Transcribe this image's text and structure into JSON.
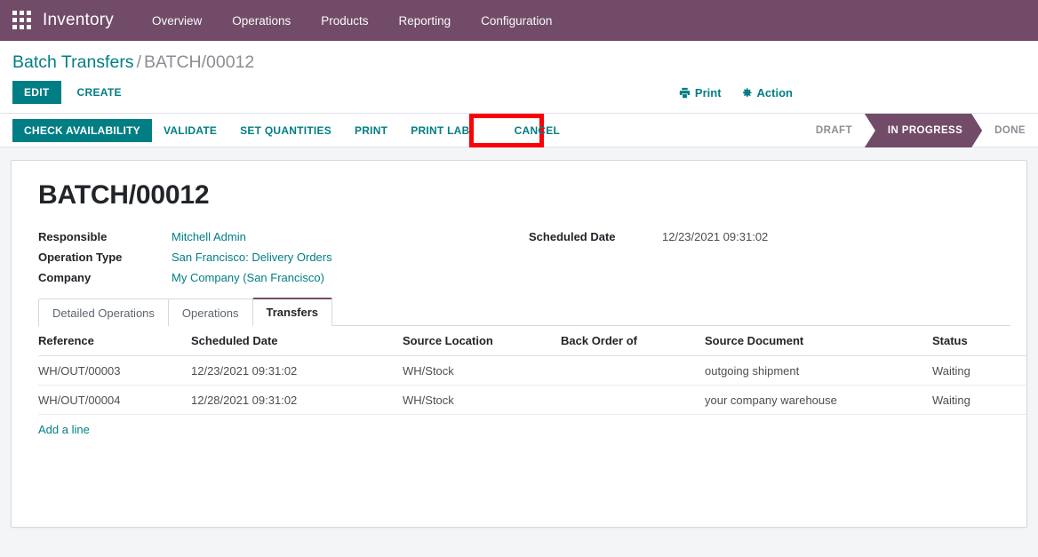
{
  "navbar": {
    "apps_icon": "apps-grid-icon",
    "brand": "Inventory",
    "menus": [
      {
        "label": "Overview"
      },
      {
        "label": "Operations"
      },
      {
        "label": "Products"
      },
      {
        "label": "Reporting"
      },
      {
        "label": "Configuration"
      }
    ]
  },
  "control_panel": {
    "breadcrumb": {
      "root": "Batch Transfers",
      "separator": "/",
      "current": "BATCH/00012"
    },
    "edit_label": "EDIT",
    "create_label": "CREATE",
    "print_label": "Print",
    "print_icon": "printer-icon",
    "action_label": "Action",
    "action_icon": "gear-icon"
  },
  "statusbar": {
    "buttons": [
      {
        "label": "CHECK AVAILABILITY",
        "style": "primary",
        "highlighted": false
      },
      {
        "label": "VALIDATE",
        "style": "secondary",
        "highlighted": false
      },
      {
        "label": "SET QUANTITIES",
        "style": "secondary",
        "highlighted": false
      },
      {
        "label": "PRINT",
        "style": "secondary",
        "highlighted": false
      },
      {
        "label": "PRINT LABELS",
        "style": "secondary",
        "highlighted": false
      },
      {
        "label": "CANCEL",
        "style": "secondary",
        "highlighted": true
      }
    ],
    "stages": [
      {
        "label": "DRAFT",
        "active": false
      },
      {
        "label": "IN PROGRESS",
        "active": true
      },
      {
        "label": "DONE",
        "active": false
      }
    ],
    "highlight_color": "#fb0007"
  },
  "form": {
    "title": "BATCH/00012",
    "left_fields": [
      {
        "label": "Responsible",
        "value": "Mitchell Admin",
        "link": true
      },
      {
        "label": "Operation Type",
        "value": "San Francisco: Delivery Orders",
        "link": true
      },
      {
        "label": "Company",
        "value": "My Company (San Francisco)",
        "link": true
      }
    ],
    "right_fields": [
      {
        "label": "Scheduled Date",
        "value": "12/23/2021 09:31:02",
        "link": false
      }
    ]
  },
  "notebook": {
    "tabs": [
      {
        "label": "Detailed Operations",
        "active": false
      },
      {
        "label": "Operations",
        "active": false
      },
      {
        "label": "Transfers",
        "active": true
      }
    ]
  },
  "table": {
    "columns": [
      "Reference",
      "Scheduled Date",
      "Source Location",
      "Back Order of",
      "Source Document",
      "Status"
    ],
    "optional_columns_icon": "vertical-dots-icon",
    "rows": [
      {
        "reference": "WH/OUT/00003",
        "scheduled_date": "12/23/2021 09:31:02",
        "source_location": "WH/Stock",
        "back_order_of": "",
        "source_document": "outgoing shipment",
        "status": "Waiting",
        "delete_icon": "✖"
      },
      {
        "reference": "WH/OUT/00004",
        "scheduled_date": "12/28/2021 09:31:02",
        "source_location": "WH/Stock",
        "back_order_of": "",
        "source_document": "your company warehouse",
        "status": "Waiting",
        "delete_icon": "✖"
      }
    ],
    "add_line_label": "Add a line"
  },
  "colors": {
    "brand_purple": "#714B67",
    "accent_teal": "#017e84",
    "highlight_red": "#fb0007",
    "page_bg": "#f4f5f7"
  }
}
